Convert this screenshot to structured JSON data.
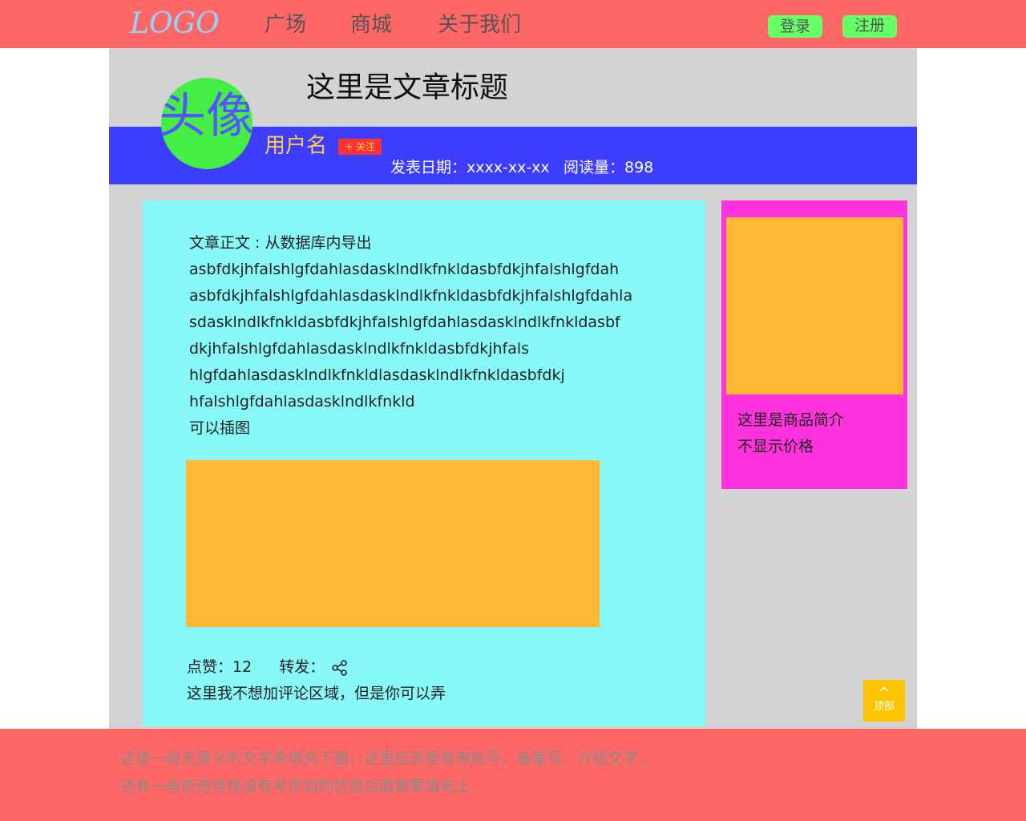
{
  "header": {
    "logo": "LOGO",
    "nav": [
      "广场",
      "商城",
      "关于我们"
    ],
    "login_label": "登录",
    "register_label": "注册"
  },
  "article": {
    "title": "这里是文章标题",
    "avatar_text": "头像",
    "username": "用户名",
    "follow_label": "+ 关注",
    "date": "发表日期：xxxx-xx-xx",
    "views": "阅读量：898",
    "body_lines": [
      "文章正文 : 从数据库内导出",
      "asbfdkjhfalshlgfdahlasdasklndlkfnkldasbfdkjhfalshlgfdah",
      "asbfdkjhfalshlgfdahlasdasklndlkfnkldasbfdkjhfalshlgfdahla",
      "sdasklndlkfnkldasbfdkjhfalshlgfdahlasdasklndlkfnkldasbf",
      "dkjhfalshlgfdahlasdasklndlkfnkldasbfdkjhfals",
      "hlgfdahlasdasklndlkfnkldlasdasklndlkfnkldasbfdkj",
      "hfalshlgfdahlasdasklndlkfnkld",
      "可以插图"
    ],
    "likes": "点赞：12",
    "share": "转发：",
    "comment_note": "这里我不想加评论区域，但是你可以弄"
  },
  "sidebar": {
    "product_lines": [
      "这里是商品简介",
      "不显示价格"
    ]
  },
  "back_top": {
    "arrow": "^",
    "label": "顶部"
  },
  "footer": {
    "lines": [
      "这是一段无意义的文字来填充下面，这里应该是有审批号，备案号，介绍文字，",
      "还有一些奇奇怪怪没有考虑到的信息后面需要填充上"
    ]
  },
  "colors": {
    "topbar": "#ff6666",
    "author_bar": "#3d3dff",
    "article_bg": "#88f7f7",
    "sidebar_bg": "#ff33dd",
    "image_placeholder": "#ffb833",
    "button_green": "#66ff66",
    "back_top": "#ffc400"
  }
}
